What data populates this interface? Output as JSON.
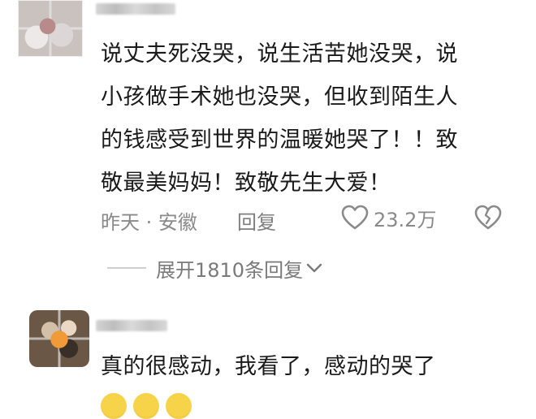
{
  "comments": [
    {
      "text_lines": [
        "说丈夫死没哭，说生活苦她没哭，说",
        "小孩做手术她也没哭，但收到陌生人",
        "的钱感受到世界的温暖她哭了！！致",
        "敬最美妈妈！致敬先生大爱！"
      ],
      "time_location": "昨天 · 安徽",
      "reply_label": "回复",
      "like_count": "23.2万",
      "icons": {
        "like": "heart-outline-icon",
        "dislike": "broken-heart-icon"
      }
    },
    {
      "text": "真的很感动，我看了，感动的哭了"
    }
  ],
  "expand_replies": {
    "label": "展开1810条回复",
    "icon": "chevron-down-icon"
  },
  "colors": {
    "text": "#1a1a1a",
    "meta": "#8a8a8a",
    "divider": "#cfcfcf"
  }
}
